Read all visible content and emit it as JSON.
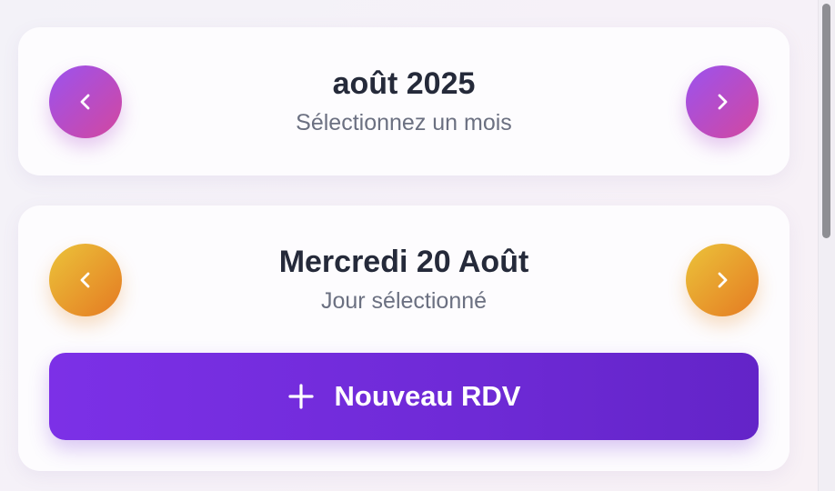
{
  "month_selector": {
    "title": "août 2025",
    "subtitle": "Sélectionnez un mois",
    "prev_icon": "chevron-left-icon",
    "next_icon": "chevron-right-icon",
    "gradient": [
      "#9b52ef",
      "#d3479f"
    ]
  },
  "day_selector": {
    "title": "Mercredi 20 Août",
    "subtitle": "Jour sélectionné",
    "prev_icon": "chevron-left-icon",
    "next_icon": "chevron-right-icon",
    "gradient": [
      "#ebc33a",
      "#e57a22"
    ]
  },
  "new_appointment": {
    "label": "Nouveau RDV",
    "icon": "plus-icon",
    "color": "#7c30e7"
  }
}
